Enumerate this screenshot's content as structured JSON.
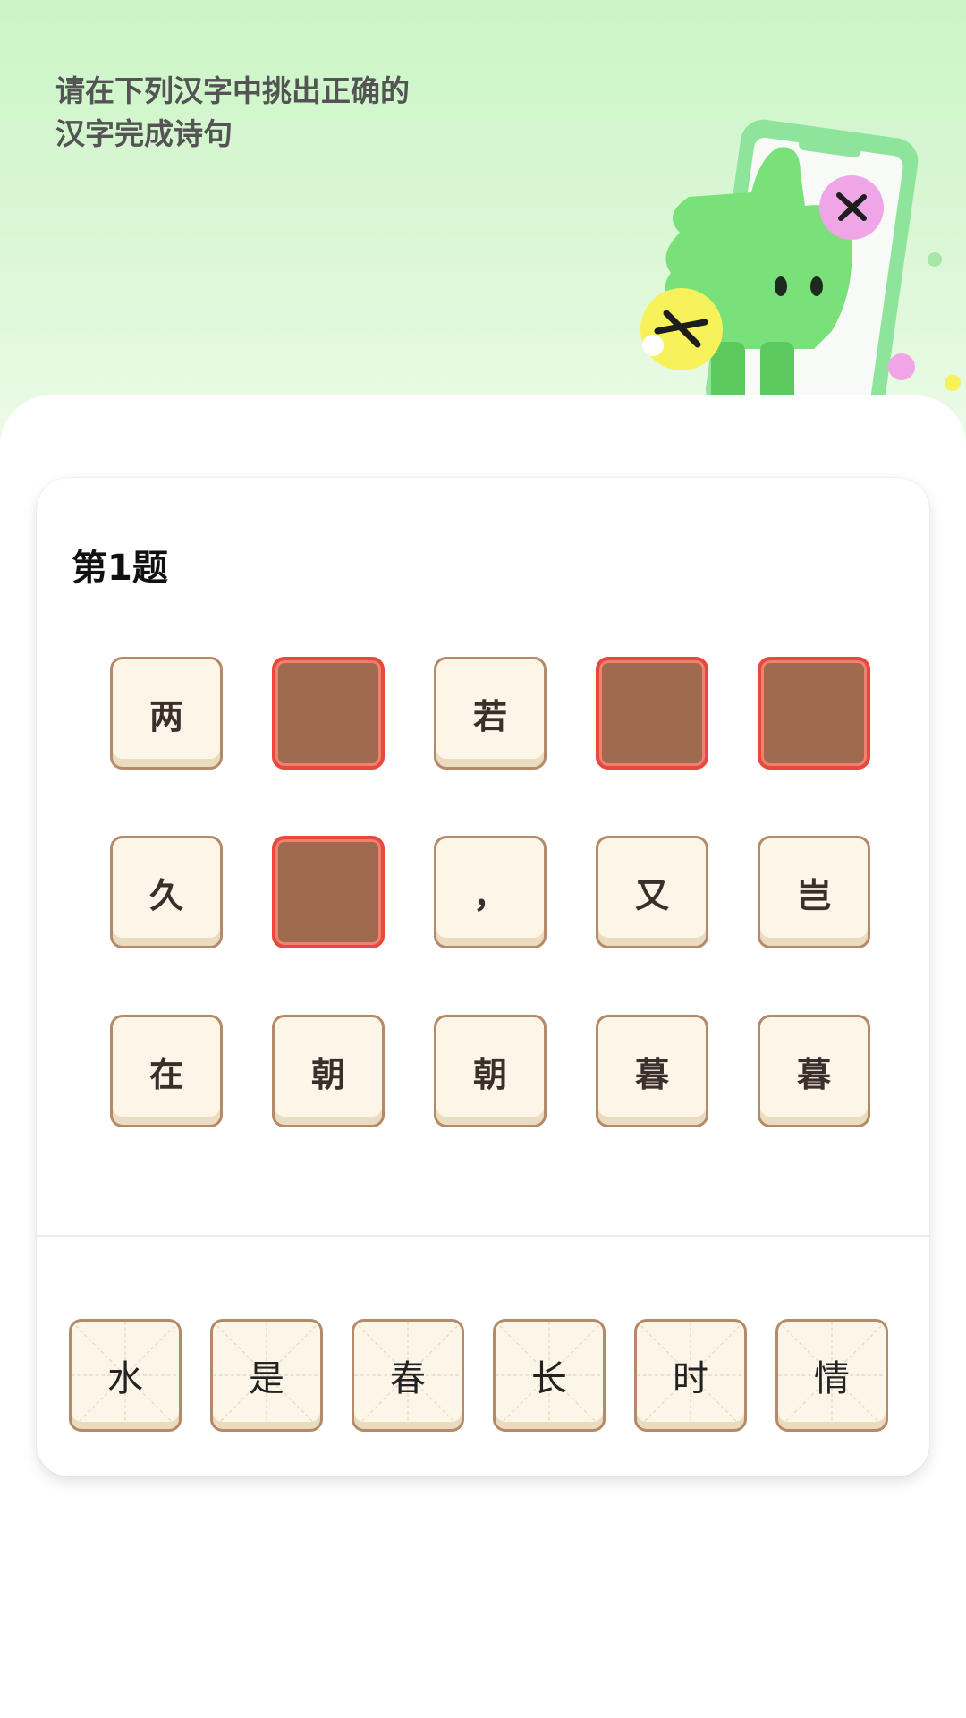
{
  "instruction": "请在下列汉字中挑出正确的\n汉字完成诗句",
  "question": {
    "title": "第1题"
  },
  "poem_slots": [
    {
      "char": "两",
      "state": "filled"
    },
    {
      "char": "",
      "state": "empty"
    },
    {
      "char": "若",
      "state": "filled"
    },
    {
      "char": "",
      "state": "empty"
    },
    {
      "char": "",
      "state": "empty"
    },
    {
      "char": "久",
      "state": "filled"
    },
    {
      "char": "",
      "state": "empty"
    },
    {
      "char": "，",
      "state": "filled"
    },
    {
      "char": "又",
      "state": "filled"
    },
    {
      "char": "岂",
      "state": "filled"
    },
    {
      "char": "在",
      "state": "filled"
    },
    {
      "char": "朝",
      "state": "filled"
    },
    {
      "char": "朝",
      "state": "filled"
    },
    {
      "char": "暮",
      "state": "filled"
    },
    {
      "char": "暮",
      "state": "filled"
    }
  ],
  "answer_options": [
    "水",
    "是",
    "春",
    "长",
    "时",
    "情"
  ],
  "colors": {
    "empty_slot_fill": "#a06a4e",
    "empty_slot_border": "#e9483c",
    "tile_fill": "#fcf6e8",
    "tile_border": "#b58a6a",
    "banner_green": "#cbf5c6",
    "mascot_green": "#79e07a"
  },
  "icons": {
    "mascot": "thumb-mascot-illustration",
    "wrong_marks": "x-mark-icon"
  }
}
